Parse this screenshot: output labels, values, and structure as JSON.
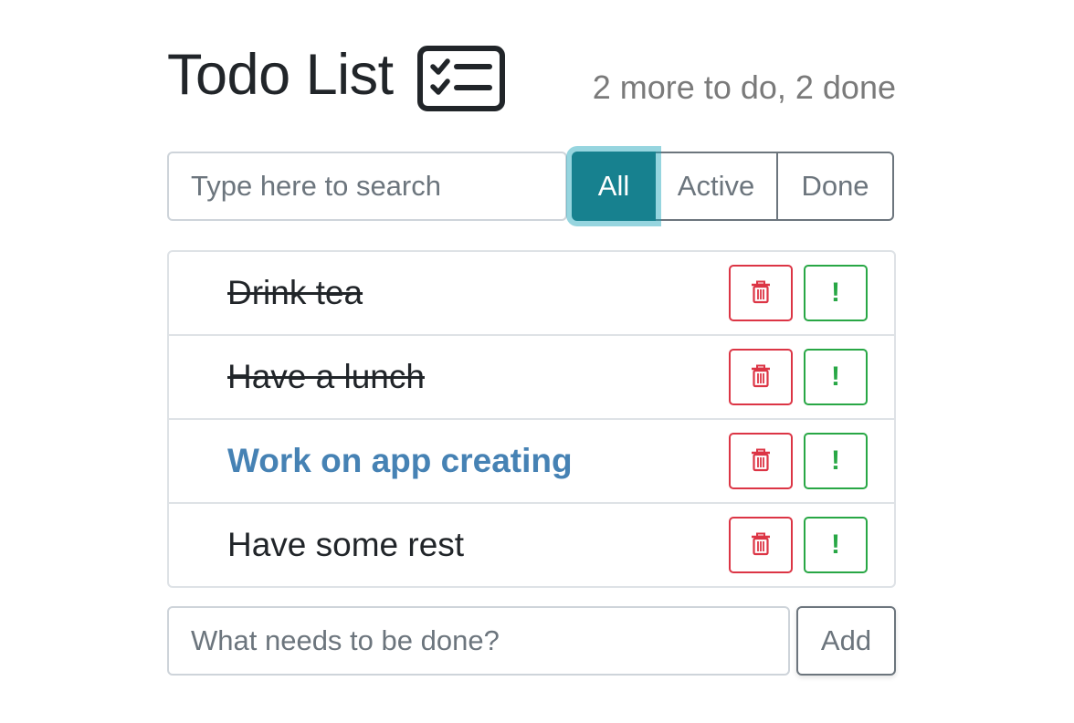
{
  "header": {
    "title": "Todo List",
    "title_icon": "checklist-icon",
    "stats": "2 more to do, 2 done"
  },
  "search": {
    "placeholder": "Type here to search",
    "value": ""
  },
  "filters": [
    {
      "label": "All",
      "selected": true
    },
    {
      "label": "Active",
      "selected": false
    },
    {
      "label": "Done",
      "selected": false
    }
  ],
  "todos": [
    {
      "label": "Drink tea",
      "done": true,
      "important": false
    },
    {
      "label": "Have a lunch",
      "done": true,
      "important": false
    },
    {
      "label": "Work on app creating",
      "done": false,
      "important": true
    },
    {
      "label": "Have some rest",
      "done": false,
      "important": false
    }
  ],
  "item_buttons": {
    "delete_icon": "trash-icon",
    "important_icon": "exclamation-icon",
    "important_glyph": "!"
  },
  "add_form": {
    "placeholder": "What needs to be done?",
    "value": "",
    "button_label": "Add"
  },
  "colors": {
    "selected_filter": "#17818f",
    "important_text": "#4682b4",
    "delete_border": "#dc3545",
    "important_border": "#28a745",
    "stats_text": "#7a7a7a"
  }
}
